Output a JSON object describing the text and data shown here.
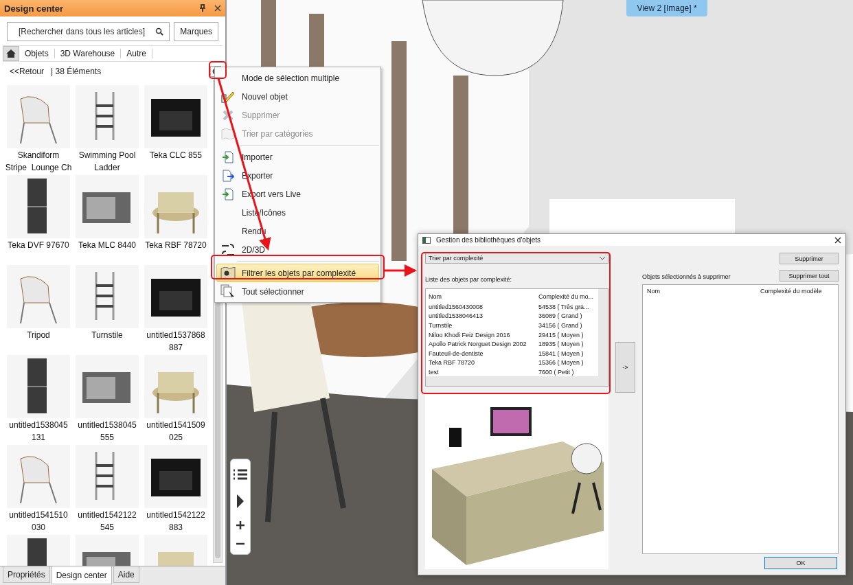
{
  "panel": {
    "title": "Design center",
    "search": {
      "placeholder": "[Rechercher dans tous les articles]"
    },
    "brands_button": "Marques",
    "breadcrumb": [
      "Objets",
      "3D Warehouse",
      "Autre"
    ],
    "back": "<<Retour",
    "count": "| 38 Éléments",
    "items": [
      {
        "kind": "item",
        "lines": [
          "Skandiform",
          "Stripe  Lounge Ch"
        ]
      },
      {
        "kind": "item",
        "lines": [
          "Swimming Pool",
          "Ladder"
        ]
      },
      {
        "kind": "item",
        "lines": [
          "Teka CLC 855"
        ]
      },
      {
        "kind": "item",
        "lines": [
          "Teka DVF 97670"
        ]
      },
      {
        "kind": "item",
        "lines": [
          "Teka MLC 8440"
        ]
      },
      {
        "kind": "item",
        "lines": [
          "Teka RBF 78720"
        ]
      },
      {
        "kind": "item",
        "lines": [
          "Tripod"
        ]
      },
      {
        "kind": "item",
        "lines": [
          "Turnstile"
        ]
      },
      {
        "kind": "item",
        "lines": [
          "untitled1537868",
          "887"
        ]
      },
      {
        "kind": "item",
        "lines": [
          "untitled1538045",
          "131"
        ]
      },
      {
        "kind": "item",
        "lines": [
          "untitled1538045",
          "555"
        ]
      },
      {
        "kind": "item",
        "lines": [
          "untitled1541509",
          "025"
        ]
      },
      {
        "kind": "item",
        "lines": [
          "untitled1541510",
          "030"
        ]
      },
      {
        "kind": "item",
        "lines": [
          "untitled1542122",
          "545"
        ]
      },
      {
        "kind": "item",
        "lines": [
          "untitled1542122",
          "883"
        ]
      },
      {
        "kind": "picture"
      },
      {
        "kind": "picture"
      },
      {
        "kind": "picture"
      }
    ],
    "tabs": [
      {
        "label": "Propriétés",
        "selected": false
      },
      {
        "label": "Design center",
        "selected": true
      },
      {
        "label": "Aide",
        "selected": false
      }
    ]
  },
  "view_tab": "View 2 [Image] *",
  "menu": [
    {
      "kind": "item",
      "label": "Mode de sélection multiple",
      "disabled": false,
      "selected": false
    },
    {
      "kind": "item",
      "label": "Nouvel objet",
      "disabled": false,
      "selected": false
    },
    {
      "kind": "item",
      "label": "Supprimer",
      "disabled": true,
      "selected": false
    },
    {
      "kind": "item",
      "label": "Trier par catégories",
      "disabled": true,
      "selected": false
    },
    {
      "kind": "separator"
    },
    {
      "kind": "item",
      "label": "Importer",
      "disabled": false,
      "selected": false
    },
    {
      "kind": "item",
      "label": "Exporter",
      "disabled": false,
      "selected": false
    },
    {
      "kind": "item",
      "label": "Export vers Live",
      "disabled": false,
      "selected": false
    },
    {
      "kind": "item",
      "label": "Liste/Icônes",
      "disabled": false,
      "selected": false
    },
    {
      "kind": "item",
      "label": "Rendu",
      "disabled": false,
      "selected": false
    },
    {
      "kind": "item",
      "label": "2D/3D",
      "disabled": false,
      "selected": false
    },
    {
      "kind": "separator"
    },
    {
      "kind": "item",
      "label": "Filtrer les objets par complexité",
      "disabled": false,
      "selected": true
    },
    {
      "kind": "item",
      "label": "Tout sélectionner",
      "disabled": false,
      "selected": false
    }
  ],
  "dialog": {
    "title": "Gestion des bibliothèques d'objets",
    "sort": {
      "value": "Trier par complexité"
    },
    "list_label": "Liste des objets par complexité:",
    "columns": [
      "Nom",
      "Complexité du mo..."
    ],
    "rows": [
      [
        "untitled1560430008",
        "54538 ( Très gra..."
      ],
      [
        "untitled1538046413",
        "36089 ( Grand )"
      ],
      [
        "Turnstile",
        "34156 ( Grand )"
      ],
      [
        "Niloo Khodi Feiz Design 2016",
        "29415 ( Moyen )"
      ],
      [
        "Apollo Patrick Norguet Design 2002",
        "18935 ( Moyen )"
      ],
      [
        "Fauteuil-de-dentiste",
        "15841 ( Moyen )"
      ],
      [
        "Teka RBF 78720",
        "15366 ( Moyen )"
      ],
      [
        "test",
        "7600 ( Petit )"
      ]
    ],
    "move_button": "->",
    "delete_button": "Supprimer",
    "delete_all_button": "Supprimer tout",
    "selected_label": "Objets sélectionnés à supprimer",
    "selected_columns": [
      "Nom",
      "Complexité du modèle"
    ],
    "ok_button": "OK"
  }
}
